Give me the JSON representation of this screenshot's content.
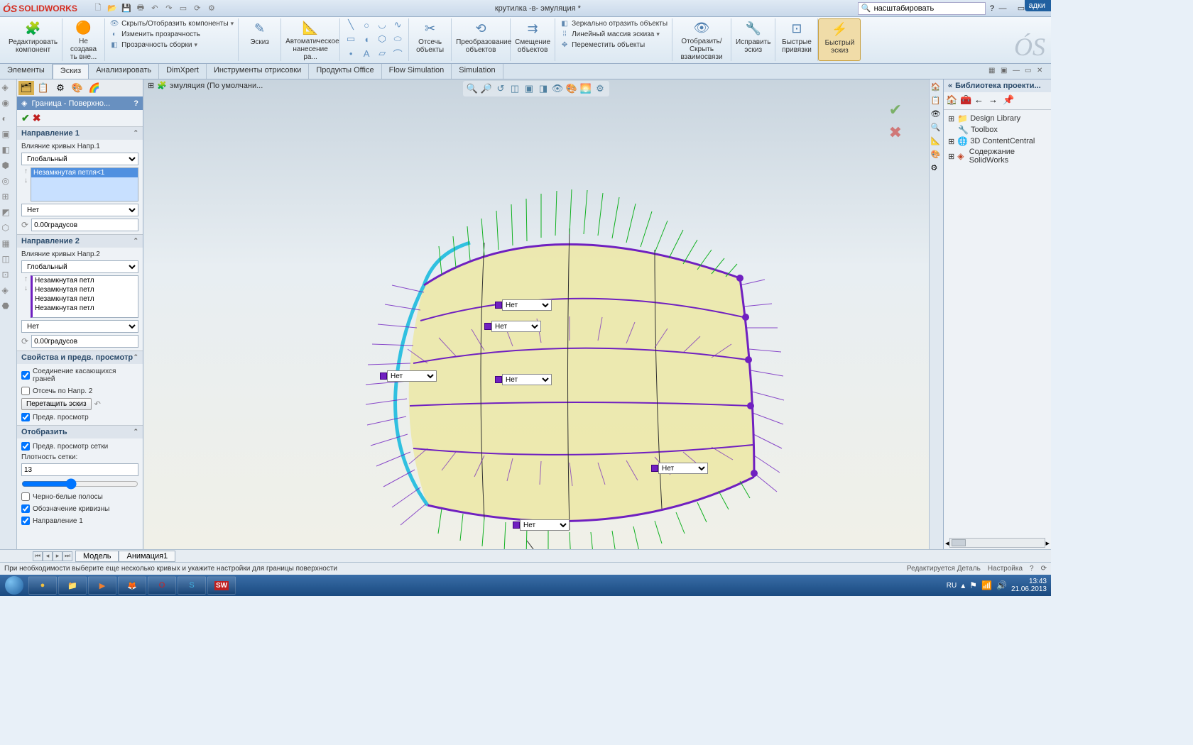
{
  "app": {
    "name": "SOLIDWORKS",
    "doc_title": "крутилка -в- эмуляция *",
    "search_placeholder": "насштабировать"
  },
  "remote_tab": "адки",
  "ribbon": {
    "g_edit_component": "Редактировать\nкомпонент",
    "g_no_create": "Не\nсоздава\nть вне...",
    "row_hide": "Скрыть/Отобразить компоненты",
    "row_trans": "Изменить прозрачность",
    "row_assy": "Прозрачность сборки",
    "g_sketch": "Эскиз",
    "g_auto": "Автоматическое\nнанесение ра...",
    "g_trim": "Отсечь\nобъекты",
    "g_convert": "Преобразование\nобъектов",
    "g_offset": "Смещение\nобъектов",
    "row_mirror": "Зеркально отразить объекты",
    "row_linear": "Линейный массив эскиза",
    "row_move": "Переместить объекты",
    "g_show_hide": "Отобразить/Скрыть\nвзаимосвязи",
    "g_repair": "Исправить\nэскиз",
    "g_quick_snaps": "Быстрые\nпривязки",
    "g_rapid": "Быстрый\nэскиз"
  },
  "tabs": [
    "Элементы",
    "Эскиз",
    "Анализировать",
    "DimXpert",
    "Инструменты отрисовки",
    "Продукты Office",
    "Flow Simulation",
    "Simulation"
  ],
  "breadcrumb": "эмуляция  (По умолчани...",
  "pm": {
    "title": "Граница - Поверхно...",
    "d1": {
      "head": "Направление 1",
      "lbl": "Влияние кривых Напр.1",
      "sel": "Глобальный",
      "list": "Незамкнутая петля<1",
      "none": "Нет",
      "deg": "0.00градусов"
    },
    "d2": {
      "head": "Направление 2",
      "lbl": "Влияние кривых Напр.2",
      "sel": "Глобальный",
      "items": [
        "Незамкнутая петл",
        "Незамкнутая петл",
        "Незамкнутая петл",
        "Незамкнутая петл"
      ],
      "none": "Нет",
      "deg": "0.00градусов"
    },
    "props": {
      "head": "Свойства и предв. просмотр",
      "merge": "Соединение касающихся граней",
      "trim": "Отсечь по Напр. 2",
      "drag": "Перетащить эскиз",
      "preview": "Предв. просмотр"
    },
    "display": {
      "head": "Отобразить",
      "mesh": "Предв. просмотр сетки",
      "density_lbl": "Плотность сетки:",
      "density": "13",
      "zebra": "Черно-белые полосы",
      "curv": "Обозначение кривизны",
      "d1": "Направление 1"
    }
  },
  "dd": {
    "opt": "Нет"
  },
  "rpanel": {
    "title": "Библиотека проекти...",
    "items": [
      "Design Library",
      "Toolbox",
      "3D ContentCentral",
      "Содержание SolidWorks"
    ]
  },
  "btabs": [
    "Модель",
    "Анимация1"
  ],
  "status": {
    "hint": "При необходимости выберите еще несколько кривых и укажите настройки для границы поверхности",
    "mode": "Редактируется Деталь",
    "custom": "Настройка"
  },
  "tray": {
    "lang": "RU",
    "time": "13:43",
    "date": "21.06.2013"
  }
}
